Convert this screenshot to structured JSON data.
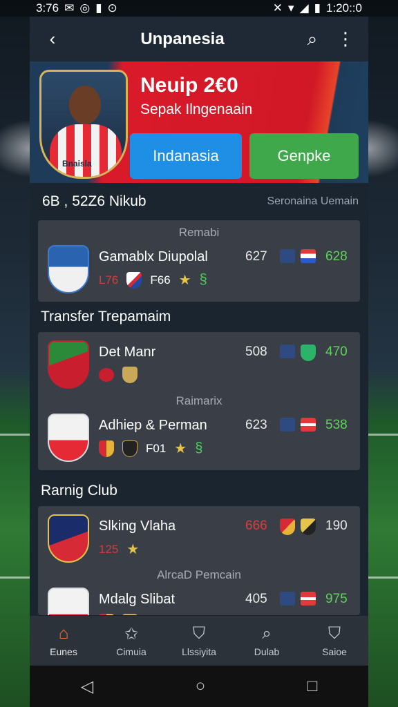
{
  "status": {
    "time_left": "3:76",
    "time_right": "1:20::0",
    "icons_left": [
      "mail-icon",
      "circle-icon",
      "battery-small-icon",
      "record-icon"
    ],
    "icons_right": [
      "mute-icon",
      "wifi-icon",
      "signal-icon",
      "battery-icon"
    ]
  },
  "appbar": {
    "back_icon": "back-arrow-icon",
    "title": "Unpanesia",
    "search_icon": "search-icon",
    "menu_icon": "overflow-menu-icon"
  },
  "hero": {
    "headline": "Neuip 2€0",
    "subline": "Sepak Ilngenaain",
    "button_blue": "Indanasia",
    "button_green": "Genpke",
    "shirt_text": "Bnaisla"
  },
  "section1": {
    "title": "6B , 52Z6 Nikub",
    "subtitle": "Seronaina Uemain",
    "caption": "Remabi",
    "rows": [
      {
        "name": "Gamablx Diupolal",
        "sub_red": "L76",
        "sub_text": "F66",
        "mid": "627",
        "score": "628"
      }
    ]
  },
  "section2": {
    "title": "Transfer Trepamaim",
    "caption_mid": "Raimarix",
    "rows": [
      {
        "name": "Det Manr",
        "mid": "508",
        "score": "470"
      },
      {
        "name": "Adhiep & Perman",
        "sub_text": "F01",
        "mid": "623",
        "score": "538"
      }
    ]
  },
  "section3": {
    "title": "Rarnig Club",
    "caption_mid": "AlrcaD Pemcain",
    "rows": [
      {
        "name": "Slking Vlaha",
        "sub_red": "125",
        "mid_red": "666",
        "score": "190"
      },
      {
        "name": "Mdalg Slibat",
        "mid": "405",
        "score": "975"
      }
    ]
  },
  "bottom_nav": [
    {
      "label": "Eunes",
      "icon": "home-icon"
    },
    {
      "label": "Cimuia",
      "icon": "star-badge-icon"
    },
    {
      "label": "Llssiyita",
      "icon": "shield-icon"
    },
    {
      "label": "Dulab",
      "icon": "search-icon"
    },
    {
      "label": "Saioe",
      "icon": "shield-icon"
    }
  ],
  "colors": {
    "accent_red": "#d91a2a",
    "button_blue": "#1f8fe6",
    "button_green": "#3fa84a",
    "score_green": "#5fd35a",
    "active_nav": "#ff6a3a"
  }
}
